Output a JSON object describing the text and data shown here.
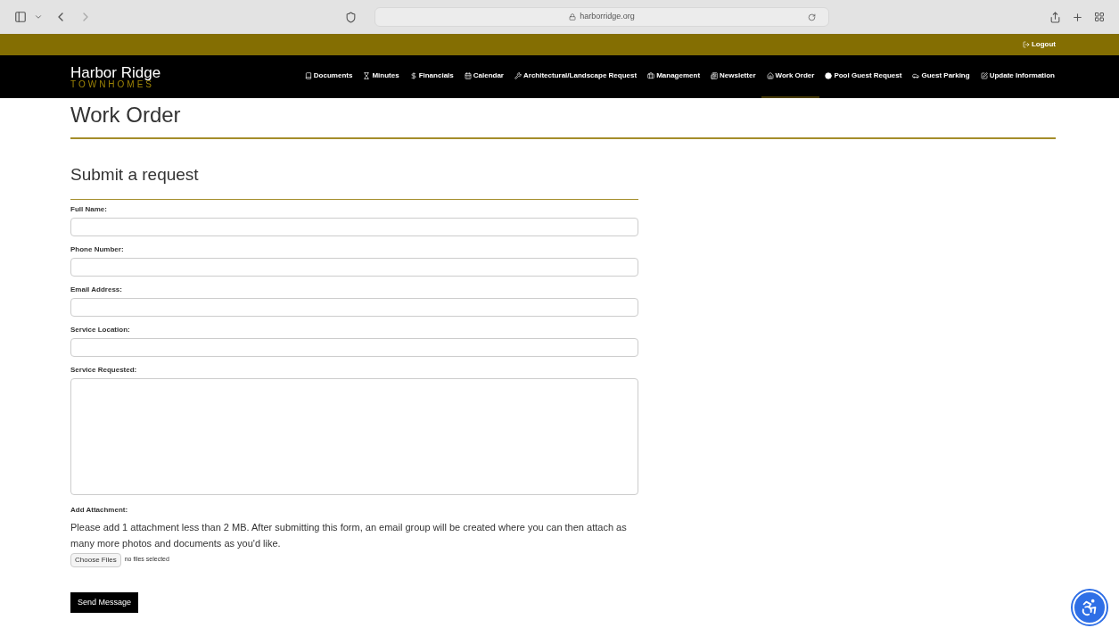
{
  "browser": {
    "address": "harborridge.org"
  },
  "top_bar": {
    "logout": "Logout"
  },
  "nav": {
    "brand": "Harbor Ridge",
    "brand_sub": "TOWNHOMES",
    "items": [
      {
        "label": "Documents",
        "selected": false
      },
      {
        "label": "Minutes",
        "selected": false
      },
      {
        "label": "Financials",
        "selected": false
      },
      {
        "label": "Calendar",
        "selected": false
      },
      {
        "label": "Architectural/Landscape Request",
        "selected": false
      },
      {
        "label": "Management",
        "selected": false
      },
      {
        "label": "Newsletter",
        "selected": false
      },
      {
        "label": "Work Order",
        "selected": true
      },
      {
        "label": "Pool Guest Request",
        "selected": false
      },
      {
        "label": "Guest Parking",
        "selected": false
      },
      {
        "label": "Update Information",
        "selected": false
      }
    ]
  },
  "page_title": "Work Order",
  "form": {
    "heading": "Submit a request",
    "fields": [
      {
        "label": "Full Name:",
        "kind": "input"
      },
      {
        "label": "Phone Number:",
        "kind": "input"
      },
      {
        "label": "Email Address:",
        "kind": "input"
      },
      {
        "label": "Service Location:",
        "kind": "input"
      },
      {
        "label": "Service Requested:",
        "kind": "textarea"
      }
    ],
    "attachment": {
      "label": "Add Attachment:",
      "note": "Please add 1 attachment less than 2 MB. After submitting this form, an email group will be created where you can then attach as many more photos and documents as you'd like.",
      "button": "Choose Files",
      "status": "no files selected"
    },
    "submit": "Send Message"
  }
}
